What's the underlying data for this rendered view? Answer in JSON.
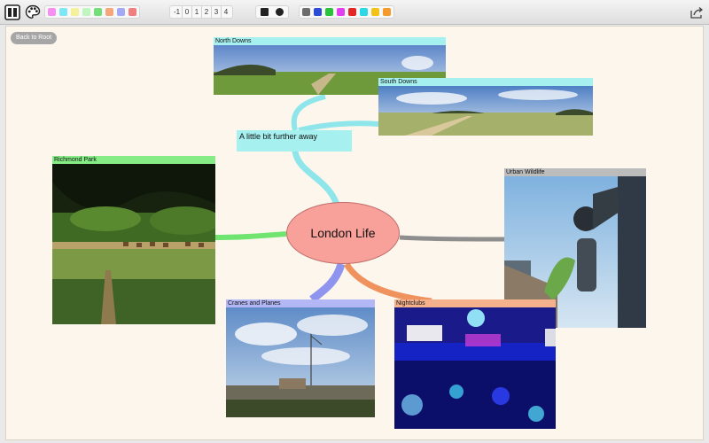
{
  "toolbar": {
    "left_icons": [
      "layout-panels-icon",
      "palette-icon"
    ],
    "pastel_colors": [
      "#f58ff0",
      "#7fe7f3",
      "#f5f09a",
      "#bff5bf",
      "#74df7a",
      "#f5a77c",
      "#a3a9f5",
      "#f27f7f"
    ],
    "levels": [
      "-1",
      "0",
      "1",
      "2",
      "3",
      "4"
    ],
    "bold_colors": [
      "#6e6e6e",
      "#2a4cd6",
      "#2ac33b",
      "#e23ff0",
      "#e32626",
      "#2cd8e6",
      "#f2c218",
      "#f59a2c"
    ],
    "share_icon": "share-icon"
  },
  "canvas": {
    "back_label": "Back to Root",
    "root_label": "London Life",
    "nodes": {
      "north_downs": "North Downs",
      "south_downs": "South Downs",
      "further_away": "A little bit further away",
      "richmond_park": "Richmond Park",
      "urban_wildlife": "Urban Wildlife",
      "cranes_planes": "Cranes and Planes",
      "nightclubs": "Nightclubs"
    },
    "colors": {
      "cyan": "#a6f0f0",
      "green": "#86ec86",
      "gray": "#bcbcbc",
      "lavender": "#b3b7f5",
      "orange": "#f5b08c",
      "root": "#f8a09a"
    }
  }
}
